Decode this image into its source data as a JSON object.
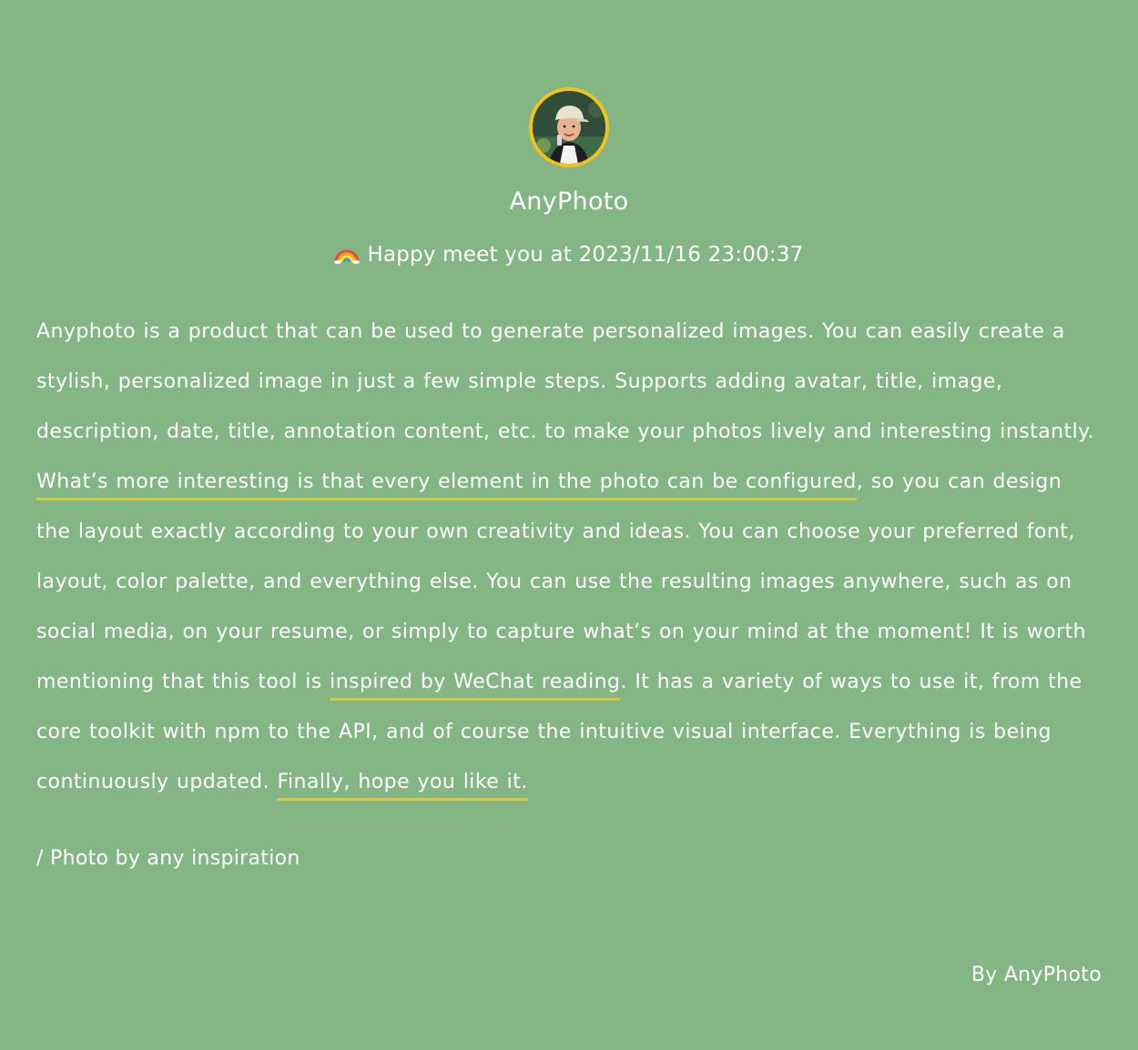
{
  "profile": {
    "name": "AnyPhoto",
    "greeting_emoji": "rainbow-icon",
    "greeting": "Happy meet you at 2023/11/16 23:00:37"
  },
  "content": {
    "part1": "Anyphoto is a product that can be used to generate personalized images. You can easily create a stylish, personalized image in just a few simple steps. Supports adding avatar, title, image, description, date, title, annotation content, etc. to make your photos lively and interesting instantly. ",
    "highlight1": "What’s more interesting is that every element in the photo can be configured",
    "part2": ", so you can design the layout exactly according to your own creativity and ideas. You can choose your preferred font, layout, color palette, and everything else. You can use the resulting images anywhere, such as on social media, on your resume, or simply to capture what‘s on your mind at the moment! It is worth mentioning that this tool is ",
    "highlight2": "inspired by WeChat reading",
    "part3": ". It has a variety of ways to use it, from the core toolkit with npm to the API, and of course the intuitive visual interface. Everything is being continuously updated. ",
    "highlight3": "Finally, hope you like it."
  },
  "byline": "/ Photo by any inspiration",
  "footer": "By AnyPhoto",
  "colors": {
    "background": "#84b584",
    "text": "#ffffff",
    "accent": "#f0c419"
  }
}
